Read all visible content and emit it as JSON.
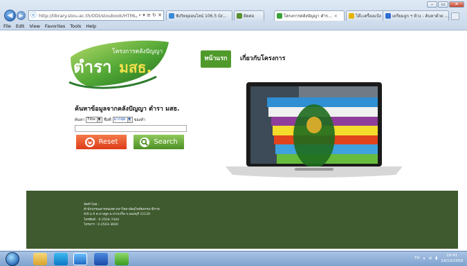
{
  "browser": {
    "address": "http://library.stou.ac.th/ODI/stoubook/HTML/",
    "tabs": [
      {
        "label": "ฟังวิทยุออนไลน์ 106.5 Gr...",
        "color": "#3a8ad6"
      },
      {
        "label": "ติดต่อ",
        "color": "#5a8f2e"
      },
      {
        "label": "โครงการคลังปัญญา ตำร...",
        "color": "#3aa23a"
      },
      {
        "label": "โต๊ะเครื่องแป้ง - Pantip",
        "color": "#e6b400"
      },
      {
        "label": "เตรียมลูก ฯ ห้าง - ค้นหาด้วย ...",
        "color": "#2f6fd1"
      }
    ],
    "menu": [
      "File",
      "Edit",
      "View",
      "Favorites",
      "Tools",
      "Help"
    ]
  },
  "logo": {
    "top_text": "โครงการคลังปัญญา",
    "main_text": "ตำรา",
    "brand": "มสธ."
  },
  "nav": {
    "home": "หน้าแรก",
    "about": "เกี่ยวกับโครงการ"
  },
  "search": {
    "title": "ค้นหาข้อมูลจากคลังปัญญา ตำรา มสธ.",
    "label_field": "ค้นหา",
    "field_value": "Title",
    "label_type": "ชื่อที่",
    "type_value": "มากสุด",
    "label_has": "ของคำ",
    "reset_label": "Reset",
    "search_label": "Search"
  },
  "footer": {
    "lines": [
      "จัดทำโดย :",
      "สำนักบรรณสารสนเทศ มหาวิทยาลัยสุโขทัยธรรมาธิราช",
      "9/9 ม.9 ต.บางพูด อ.ปากเกร็ด จ.นนทบุรี 11120",
      "โทรศัพท์ : 0-2504-7444",
      "โทรสาร : 0-2503-3600"
    ]
  },
  "taskbar": {
    "lang": "TH",
    "time": "10:41",
    "date": "14/10/2559"
  },
  "colors": {
    "green_nav": "#4f9a2b",
    "footer_bg": "#3e5a2e",
    "reset": "#e85228",
    "search": "#6fae3b"
  }
}
